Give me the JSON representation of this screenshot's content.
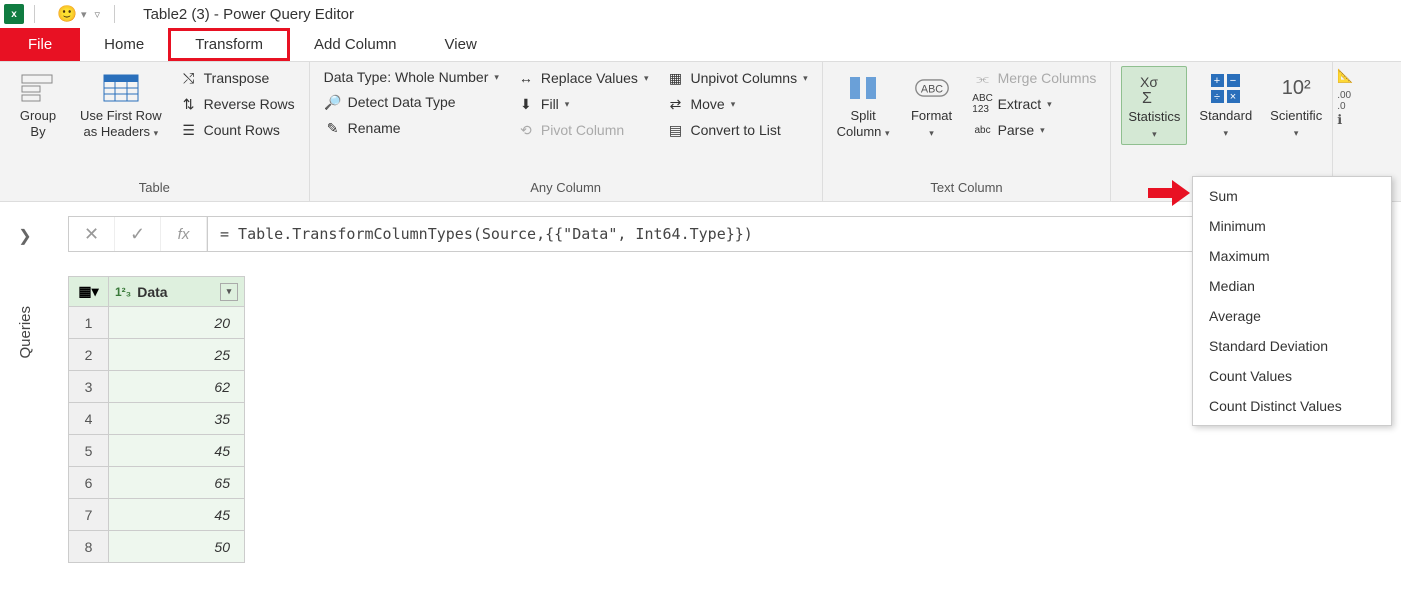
{
  "title": "Table2 (3) - Power Query Editor",
  "tabs": {
    "file": "File",
    "home": "Home",
    "transform": "Transform",
    "add_column": "Add Column",
    "view": "View"
  },
  "groups": {
    "table": {
      "label": "Table",
      "group_by": "Group\nBy",
      "use_first_row": "Use First Row\nas Headers",
      "transpose": "Transpose",
      "reverse_rows": "Reverse Rows",
      "count_rows": "Count Rows"
    },
    "any_column": {
      "label": "Any Column",
      "data_type": "Data Type: Whole Number",
      "detect": "Detect Data Type",
      "rename": "Rename",
      "replace": "Replace Values",
      "fill": "Fill",
      "pivot": "Pivot Column",
      "unpivot": "Unpivot Columns",
      "move": "Move",
      "convert": "Convert to List"
    },
    "text_column": {
      "label": "Text Column",
      "split": "Split\nColumn",
      "format": "Format",
      "merge": "Merge Columns",
      "extract": "Extract",
      "parse": "Parse"
    },
    "number_column": {
      "statistics": "Statistics",
      "standard": "Standard",
      "scientific": "Scientific"
    }
  },
  "stats_menu": [
    "Sum",
    "Minimum",
    "Maximum",
    "Median",
    "Average",
    "Standard Deviation",
    "Count Values",
    "Count Distinct Values"
  ],
  "formula": "= Table.TransformColumnTypes(Source,{{\"Data\", Int64.Type}})",
  "queries_label": "Queries",
  "column_header": "Data",
  "column_type": "1²₃",
  "rows": [
    20,
    25,
    62,
    35,
    45,
    65,
    45,
    50
  ]
}
